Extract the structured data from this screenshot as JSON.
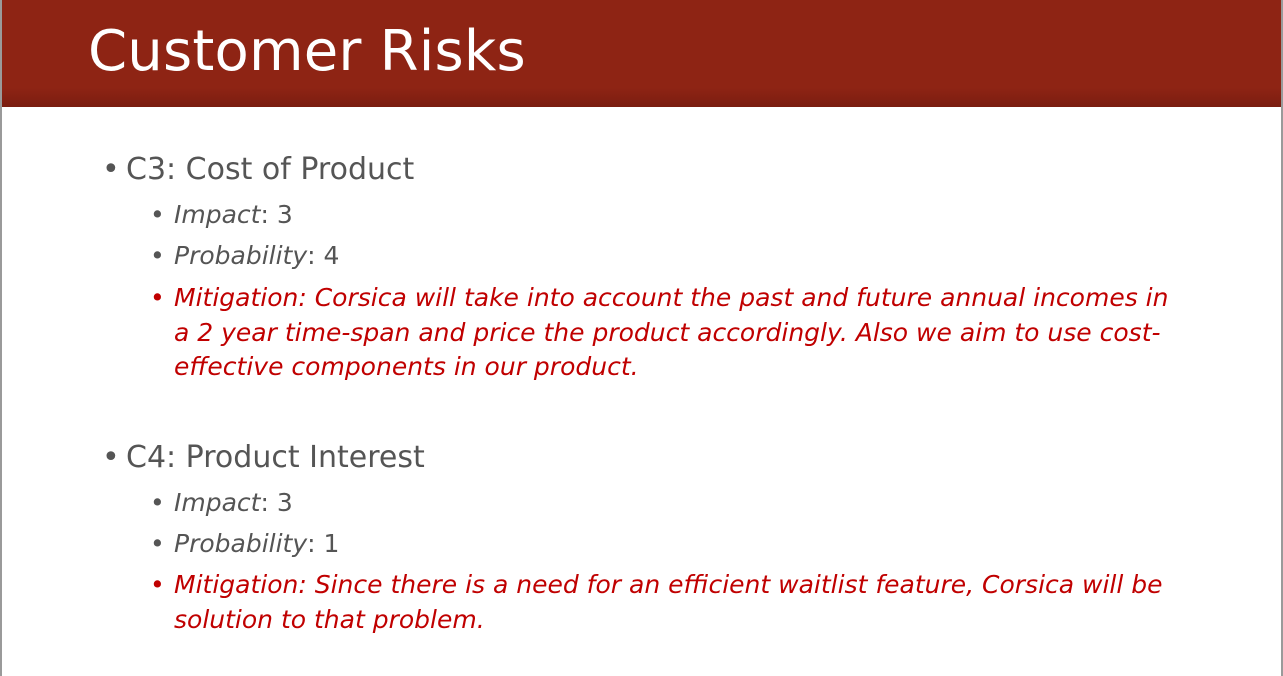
{
  "slide": {
    "title": "Customer Risks",
    "risks": [
      {
        "heading": "C3: Cost of Product",
        "impact_label": "Impact",
        "impact_value": ": 3",
        "probability_label": "Probability",
        "probability_value": ": 4",
        "mitigation": "Mitigation: Corsica will take into account the past and future annual incomes in a 2 year time-span and price the product accordingly. Also we aim to use cost-effective components in our product."
      },
      {
        "heading": "C4: Product Interest",
        "impact_label": "Impact",
        "impact_value": ": 3",
        "probability_label": "Probability",
        "probability_value": ": 1",
        "mitigation": "Mitigation: Since there is a need for an efficient waitlist feature, Corsica will be solution to that problem."
      }
    ],
    "bullet_char": "•",
    "colors": {
      "title_bar": "#8e2414",
      "title_text": "#ffffff",
      "body_text": "#555555",
      "mitigation_text": "#c00000"
    }
  }
}
